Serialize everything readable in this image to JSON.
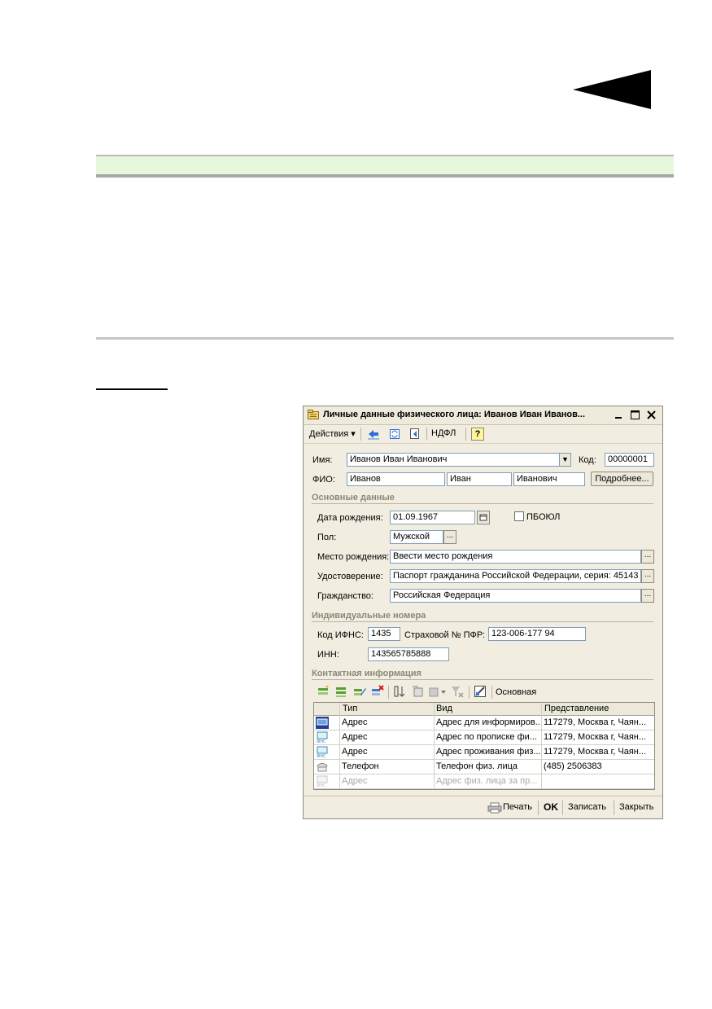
{
  "window": {
    "title": "Личные данные физического лица: Иванов Иван Иванов...",
    "toolbar": {
      "actions_label": "Действия",
      "ndfl_label": "НДФЛ",
      "help_label": "?"
    },
    "name_label": "Имя:",
    "name_value": "Иванов Иван Иванович",
    "code_label": "Код:",
    "code_value": "00000001",
    "fio_label": "ФИО:",
    "last_name": "Иванов",
    "first_name": "Иван",
    "middle_name": "Иванович",
    "details_button": "Подробнее...",
    "basic_section": "Основные данные",
    "birth_date_label": "Дата рождения:",
    "birth_date_value": "01.09.1967",
    "pboyul_label": "ПБОЮЛ",
    "gender_label": "Пол:",
    "gender_value": "Мужской",
    "birthplace_label": "Место рождения:",
    "birthplace_value": "Ввести место рождения",
    "id_doc_label": "Удостоверение:",
    "id_doc_value": "Паспорт гражданина Российской Федерации, серия: 45143",
    "citizenship_label": "Гражданство:",
    "citizenship_value": "Российская Федерация",
    "numbers_section": "Индивидуальные номера",
    "ifns_label": "Код ИФНС:",
    "ifns_value": "1435",
    "pfr_label": "Страховой № ПФР:",
    "pfr_value": "123-006-177 94",
    "inn_label": "ИНН:",
    "inn_value": "143565785888",
    "contact_section": "Контактная информация",
    "contact_toolbar_label": "Основная",
    "grid": {
      "columns": [
        "Тип",
        "Вид",
        "Представление"
      ],
      "rows": [
        {
          "type": "Адрес",
          "kind": "Адрес для информиров...",
          "value": "117279, Москва г, Чаян..."
        },
        {
          "type": "Адрес",
          "kind": "Адрес по прописке фи...",
          "value": "117279, Москва г, Чаян..."
        },
        {
          "type": "Адрес",
          "kind": "Адрес проживания физ...",
          "value": "117279, Москва г, Чаян..."
        },
        {
          "type": "Телефон",
          "kind": "Телефон физ. лица",
          "value": "(485) 2506383"
        },
        {
          "type": "Адрес",
          "kind": "Адрес физ. лица за пр...",
          "value": ""
        }
      ]
    },
    "bottom": {
      "print": "Печать",
      "ok": "OK",
      "save": "Записать",
      "close": "Закрыть"
    }
  }
}
